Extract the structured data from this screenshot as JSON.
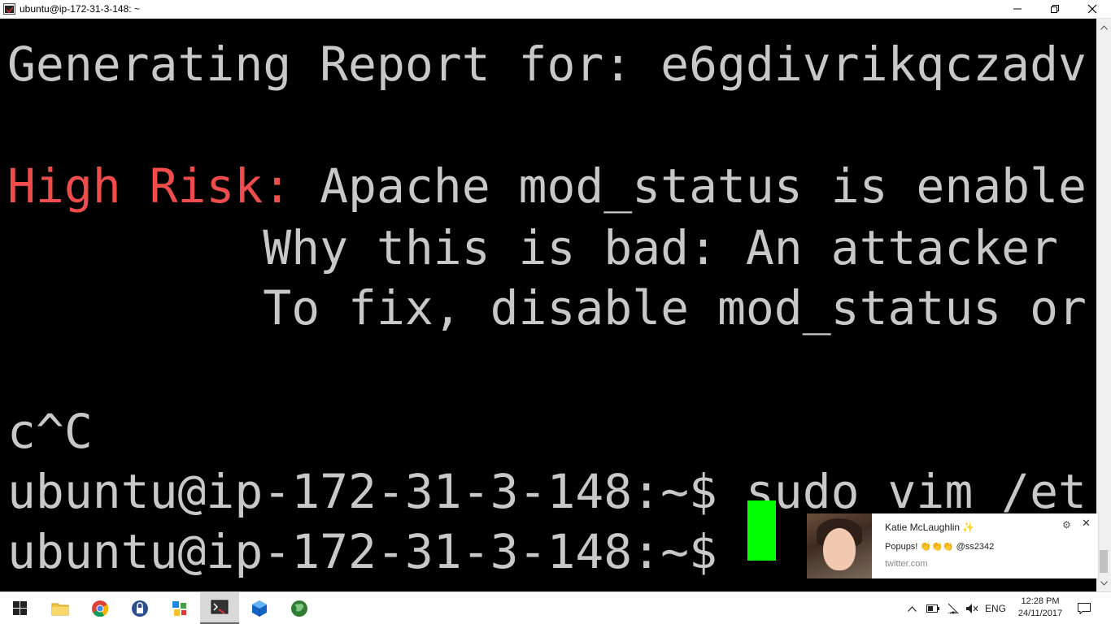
{
  "window": {
    "title": "ubuntu@ip-172-31-3-148: ~"
  },
  "terminal": {
    "line1": "Generating Report for: e6gdivrikqczadv",
    "line2_label": "High Risk:",
    "line2_text": " Apache mod_status is enable",
    "line3": "         Why this is bad: An attacker",
    "line4": "         To fix, disable mod_status or",
    "line5": "c^C",
    "line6": "ubuntu@ip-172-31-3-148:~$ sudo vim /et",
    "line7": "ubuntu@ip-172-31-3-148:~$ ",
    "text_color": "#c8c8c8",
    "risk_color": "#f14c4c",
    "cursor_color": "#00ff00"
  },
  "notification": {
    "sender": "Katie McLaughlin ✨",
    "message": "Popups! 👏👏👏 @ss2342",
    "source": "twitter.com",
    "settings_icon": "gear-icon",
    "close_icon": "close-icon"
  },
  "taskbar": {
    "items": [
      "start-icon",
      "file-explorer-icon",
      "chrome-icon",
      "keepass-icon",
      "app-icon",
      "terminal-icon",
      "virtualbox-icon",
      "globe-icon"
    ],
    "language": "ENG",
    "time": "12:28 PM",
    "date": "24/11/2017"
  }
}
